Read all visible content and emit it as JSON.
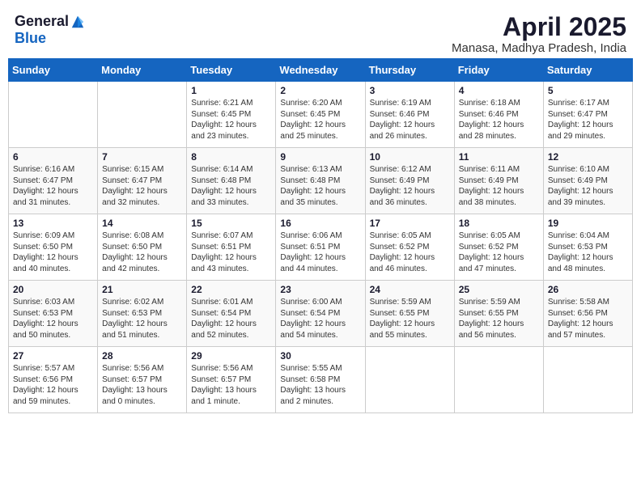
{
  "header": {
    "logo_general": "General",
    "logo_blue": "Blue",
    "title": "April 2025",
    "location": "Manasa, Madhya Pradesh, India"
  },
  "calendar": {
    "days_of_week": [
      "Sunday",
      "Monday",
      "Tuesday",
      "Wednesday",
      "Thursday",
      "Friday",
      "Saturday"
    ],
    "weeks": [
      [
        {
          "day": "",
          "info": ""
        },
        {
          "day": "",
          "info": ""
        },
        {
          "day": "1",
          "info": "Sunrise: 6:21 AM\nSunset: 6:45 PM\nDaylight: 12 hours and 23 minutes."
        },
        {
          "day": "2",
          "info": "Sunrise: 6:20 AM\nSunset: 6:45 PM\nDaylight: 12 hours and 25 minutes."
        },
        {
          "day": "3",
          "info": "Sunrise: 6:19 AM\nSunset: 6:46 PM\nDaylight: 12 hours and 26 minutes."
        },
        {
          "day": "4",
          "info": "Sunrise: 6:18 AM\nSunset: 6:46 PM\nDaylight: 12 hours and 28 minutes."
        },
        {
          "day": "5",
          "info": "Sunrise: 6:17 AM\nSunset: 6:47 PM\nDaylight: 12 hours and 29 minutes."
        }
      ],
      [
        {
          "day": "6",
          "info": "Sunrise: 6:16 AM\nSunset: 6:47 PM\nDaylight: 12 hours and 31 minutes."
        },
        {
          "day": "7",
          "info": "Sunrise: 6:15 AM\nSunset: 6:47 PM\nDaylight: 12 hours and 32 minutes."
        },
        {
          "day": "8",
          "info": "Sunrise: 6:14 AM\nSunset: 6:48 PM\nDaylight: 12 hours and 33 minutes."
        },
        {
          "day": "9",
          "info": "Sunrise: 6:13 AM\nSunset: 6:48 PM\nDaylight: 12 hours and 35 minutes."
        },
        {
          "day": "10",
          "info": "Sunrise: 6:12 AM\nSunset: 6:49 PM\nDaylight: 12 hours and 36 minutes."
        },
        {
          "day": "11",
          "info": "Sunrise: 6:11 AM\nSunset: 6:49 PM\nDaylight: 12 hours and 38 minutes."
        },
        {
          "day": "12",
          "info": "Sunrise: 6:10 AM\nSunset: 6:49 PM\nDaylight: 12 hours and 39 minutes."
        }
      ],
      [
        {
          "day": "13",
          "info": "Sunrise: 6:09 AM\nSunset: 6:50 PM\nDaylight: 12 hours and 40 minutes."
        },
        {
          "day": "14",
          "info": "Sunrise: 6:08 AM\nSunset: 6:50 PM\nDaylight: 12 hours and 42 minutes."
        },
        {
          "day": "15",
          "info": "Sunrise: 6:07 AM\nSunset: 6:51 PM\nDaylight: 12 hours and 43 minutes."
        },
        {
          "day": "16",
          "info": "Sunrise: 6:06 AM\nSunset: 6:51 PM\nDaylight: 12 hours and 44 minutes."
        },
        {
          "day": "17",
          "info": "Sunrise: 6:05 AM\nSunset: 6:52 PM\nDaylight: 12 hours and 46 minutes."
        },
        {
          "day": "18",
          "info": "Sunrise: 6:05 AM\nSunset: 6:52 PM\nDaylight: 12 hours and 47 minutes."
        },
        {
          "day": "19",
          "info": "Sunrise: 6:04 AM\nSunset: 6:53 PM\nDaylight: 12 hours and 48 minutes."
        }
      ],
      [
        {
          "day": "20",
          "info": "Sunrise: 6:03 AM\nSunset: 6:53 PM\nDaylight: 12 hours and 50 minutes."
        },
        {
          "day": "21",
          "info": "Sunrise: 6:02 AM\nSunset: 6:53 PM\nDaylight: 12 hours and 51 minutes."
        },
        {
          "day": "22",
          "info": "Sunrise: 6:01 AM\nSunset: 6:54 PM\nDaylight: 12 hours and 52 minutes."
        },
        {
          "day": "23",
          "info": "Sunrise: 6:00 AM\nSunset: 6:54 PM\nDaylight: 12 hours and 54 minutes."
        },
        {
          "day": "24",
          "info": "Sunrise: 5:59 AM\nSunset: 6:55 PM\nDaylight: 12 hours and 55 minutes."
        },
        {
          "day": "25",
          "info": "Sunrise: 5:59 AM\nSunset: 6:55 PM\nDaylight: 12 hours and 56 minutes."
        },
        {
          "day": "26",
          "info": "Sunrise: 5:58 AM\nSunset: 6:56 PM\nDaylight: 12 hours and 57 minutes."
        }
      ],
      [
        {
          "day": "27",
          "info": "Sunrise: 5:57 AM\nSunset: 6:56 PM\nDaylight: 12 hours and 59 minutes."
        },
        {
          "day": "28",
          "info": "Sunrise: 5:56 AM\nSunset: 6:57 PM\nDaylight: 13 hours and 0 minutes."
        },
        {
          "day": "29",
          "info": "Sunrise: 5:56 AM\nSunset: 6:57 PM\nDaylight: 13 hours and 1 minute."
        },
        {
          "day": "30",
          "info": "Sunrise: 5:55 AM\nSunset: 6:58 PM\nDaylight: 13 hours and 2 minutes."
        },
        {
          "day": "",
          "info": ""
        },
        {
          "day": "",
          "info": ""
        },
        {
          "day": "",
          "info": ""
        }
      ]
    ]
  }
}
